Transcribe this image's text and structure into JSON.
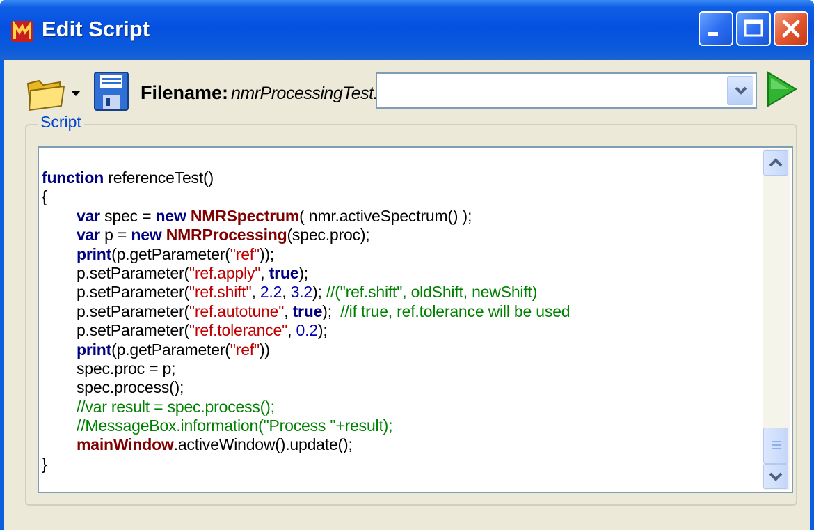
{
  "window": {
    "title": "Edit Script",
    "controls": [
      "minimize-icon",
      "maximize-icon",
      "close-icon"
    ]
  },
  "toolbar": {
    "filename_label": "Filename:",
    "filename_value": "nmrProcessingTest.qs",
    "combo_value": "",
    "icons": [
      "open-folder-icon",
      "dropdown-arrow-icon",
      "save-icon",
      "run-icon"
    ]
  },
  "script_group": {
    "label": "Script"
  },
  "colors": {
    "keyword": "#000080",
    "class": "#800000",
    "string": "#c00000",
    "number": "#0000b0",
    "comment": "#008000",
    "title_bar": "#0550e0",
    "dialog_bg": "#ece9d8"
  },
  "code": [
    {
      "indent": 0,
      "tokens": [
        {
          "t": "function",
          "k": "kw"
        },
        {
          "t": " referenceTest()",
          "k": ""
        }
      ]
    },
    {
      "indent": 0,
      "tokens": [
        {
          "t": "{",
          "k": ""
        }
      ]
    },
    {
      "indent": 1,
      "tokens": [
        {
          "t": "var",
          "k": "kw"
        },
        {
          "t": " spec = ",
          "k": ""
        },
        {
          "t": "new",
          "k": "kw"
        },
        {
          "t": " ",
          "k": ""
        },
        {
          "t": "NMRSpectrum",
          "k": "cls"
        },
        {
          "t": "( nmr.activeSpectrum() );",
          "k": ""
        }
      ]
    },
    {
      "indent": 1,
      "tokens": [
        {
          "t": "var",
          "k": "kw"
        },
        {
          "t": " p = ",
          "k": ""
        },
        {
          "t": "new",
          "k": "kw"
        },
        {
          "t": " ",
          "k": ""
        },
        {
          "t": "NMRProcessing",
          "k": "cls"
        },
        {
          "t": "(spec.proc);",
          "k": ""
        }
      ]
    },
    {
      "indent": 1,
      "tokens": [
        {
          "t": "print",
          "k": "kw"
        },
        {
          "t": "(p.getParameter(",
          "k": ""
        },
        {
          "t": "\"ref\"",
          "k": "str"
        },
        {
          "t": "));",
          "k": ""
        }
      ]
    },
    {
      "indent": 1,
      "tokens": [
        {
          "t": "p.setParameter(",
          "k": ""
        },
        {
          "t": "\"ref.apply\"",
          "k": "str"
        },
        {
          "t": ", ",
          "k": ""
        },
        {
          "t": "true",
          "k": "kw"
        },
        {
          "t": ");",
          "k": ""
        }
      ]
    },
    {
      "indent": 1,
      "tokens": [
        {
          "t": "p.setParameter(",
          "k": ""
        },
        {
          "t": "\"ref.shift\"",
          "k": "str"
        },
        {
          "t": ", ",
          "k": ""
        },
        {
          "t": "2.2",
          "k": "num"
        },
        {
          "t": ", ",
          "k": ""
        },
        {
          "t": "3.2",
          "k": "num"
        },
        {
          "t": "); ",
          "k": ""
        },
        {
          "t": "//(\"ref.shift\", oldShift, newShift)",
          "k": "cmt"
        }
      ]
    },
    {
      "indent": 1,
      "tokens": [
        {
          "t": "p.setParameter(",
          "k": ""
        },
        {
          "t": "\"ref.autotune\"",
          "k": "str"
        },
        {
          "t": ", ",
          "k": ""
        },
        {
          "t": "true",
          "k": "kw"
        },
        {
          "t": ");  ",
          "k": ""
        },
        {
          "t": "//if true, ref.tolerance will be used",
          "k": "cmt"
        }
      ]
    },
    {
      "indent": 1,
      "tokens": [
        {
          "t": "p.setParameter(",
          "k": ""
        },
        {
          "t": "\"ref.tolerance\"",
          "k": "str"
        },
        {
          "t": ", ",
          "k": ""
        },
        {
          "t": "0.2",
          "k": "num"
        },
        {
          "t": ");",
          "k": ""
        }
      ]
    },
    {
      "indent": 1,
      "tokens": [
        {
          "t": "print",
          "k": "kw"
        },
        {
          "t": "(p.getParameter(",
          "k": ""
        },
        {
          "t": "\"ref\"",
          "k": "str"
        },
        {
          "t": "))",
          "k": ""
        }
      ]
    },
    {
      "indent": 1,
      "tokens": [
        {
          "t": "spec.proc = p;",
          "k": ""
        }
      ]
    },
    {
      "indent": 1,
      "tokens": [
        {
          "t": "spec.process();",
          "k": ""
        }
      ]
    },
    {
      "indent": 1,
      "tokens": [
        {
          "t": "//var result = spec.process();",
          "k": "cmt"
        }
      ]
    },
    {
      "indent": 1,
      "tokens": [
        {
          "t": "//MessageBox.information(\"Process \"+result);",
          "k": "cmt"
        }
      ]
    },
    {
      "indent": 1,
      "tokens": [
        {
          "t": "mainWindow",
          "k": "cls"
        },
        {
          "t": ".activeWindow().update();",
          "k": ""
        }
      ]
    },
    {
      "indent": 0,
      "tokens": [
        {
          "t": "}",
          "k": ""
        }
      ]
    }
  ]
}
